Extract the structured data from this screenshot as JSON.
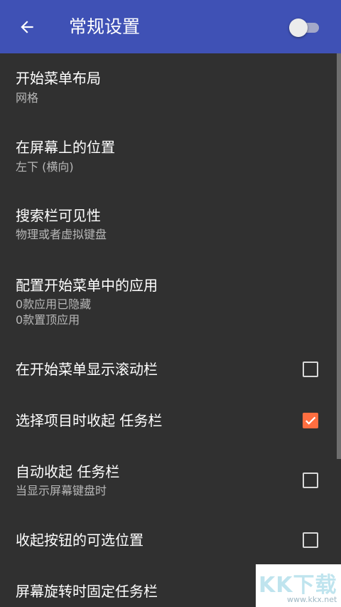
{
  "header": {
    "title": "常规设置",
    "back_icon": "arrow-left-icon",
    "switch_on": false
  },
  "items": [
    {
      "title": "开始菜单布局",
      "subtitle": "网格"
    },
    {
      "title": "在屏幕上的位置",
      "subtitle": "左下 (横向)"
    },
    {
      "title": "搜索栏可见性",
      "subtitle": "物理或者虚拟键盘"
    },
    {
      "title": "配置开始菜单中的应用",
      "subtitle": "0款应用已隐藏",
      "subtitle2": "0款置顶应用"
    },
    {
      "title": "在开始菜单显示滚动栏",
      "checked": false
    },
    {
      "title": "选择项目时收起 任务栏",
      "checked": true
    },
    {
      "title": "自动收起 任务栏",
      "subtitle": "当显示屏幕键盘时",
      "checked": false
    },
    {
      "title": "收起按钮的可选位置",
      "checked": false
    },
    {
      "title": "屏幕旋转时固定任务栏"
    }
  ],
  "watermark": {
    "brand": "KK下载",
    "url": "www.kkx.net"
  },
  "colors": {
    "appbar": "#3f51b5",
    "background": "#303030",
    "accent": "#ff6e40"
  }
}
